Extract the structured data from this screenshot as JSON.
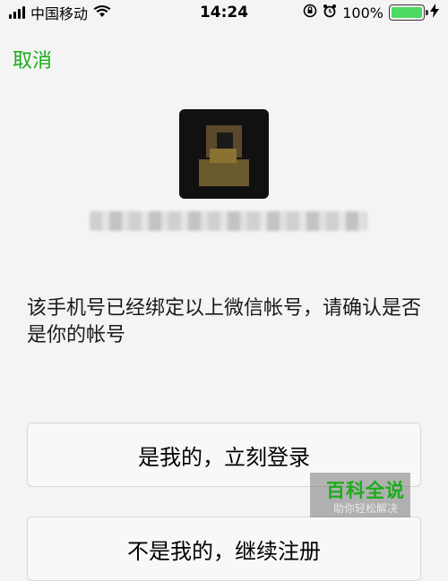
{
  "status_bar": {
    "carrier": "中国移动",
    "time": "14:24",
    "battery": "100%",
    "battery_level": 1.0
  },
  "nav": {
    "cancel_label": "取消"
  },
  "account": {
    "avatar_icon": "avatar-pixelated"
  },
  "message": "该手机号已经绑定以上微信帐号，请确认是否是你的帐号",
  "buttons": {
    "confirm_label": "是我的，立刻登录",
    "other_label": "不是我的，继续注册"
  },
  "watermark": {
    "title": "百科全说",
    "subtitle": "助你轻松解决"
  },
  "colors": {
    "accent": "#1aad19",
    "battery": "#4cd964"
  }
}
